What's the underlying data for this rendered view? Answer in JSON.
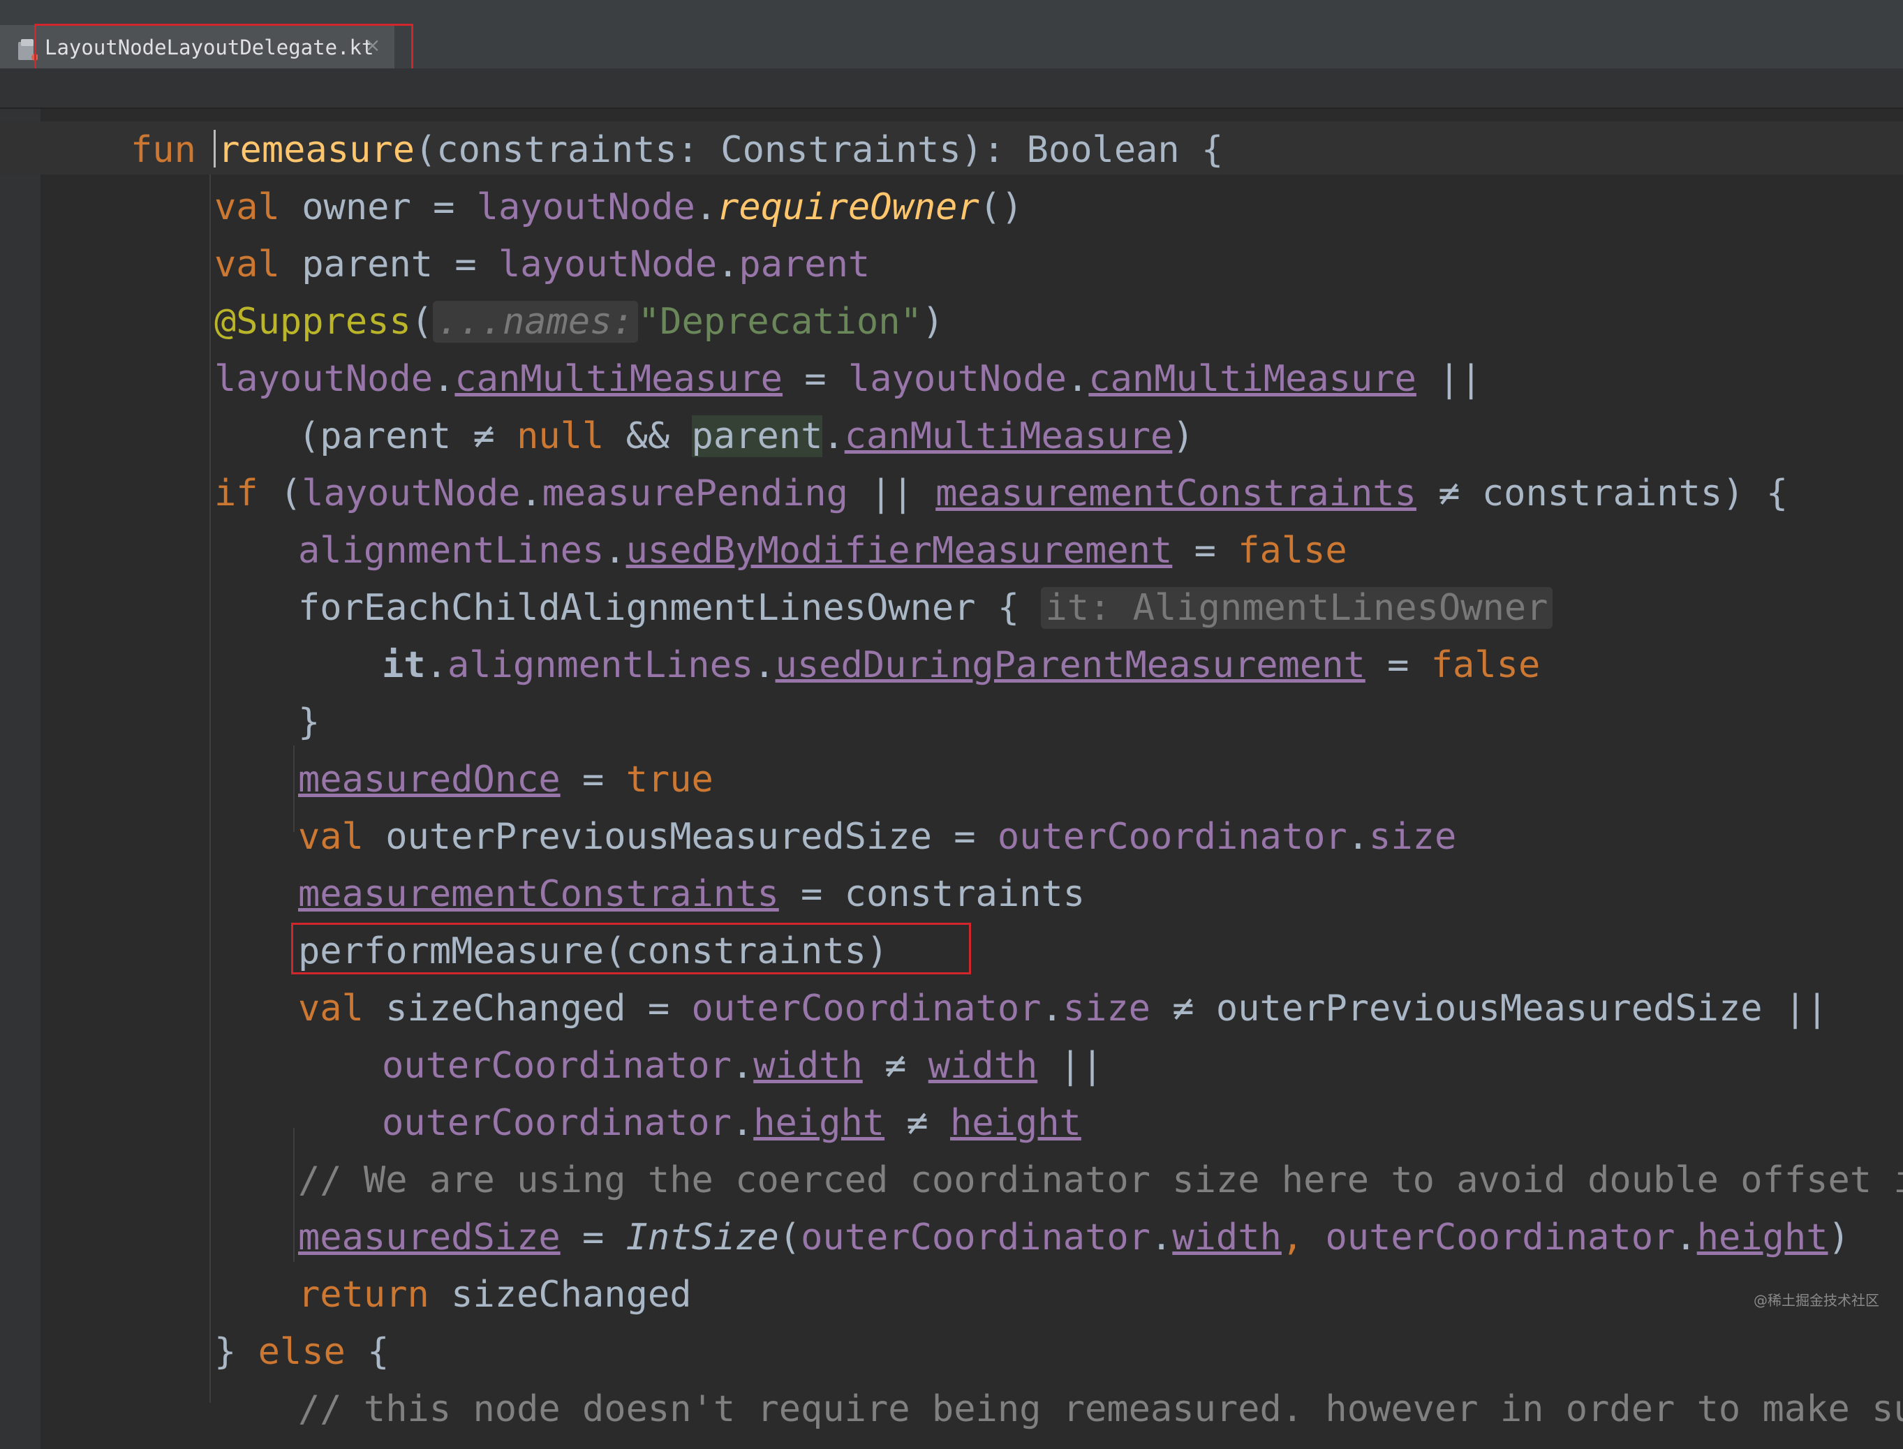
{
  "tab": {
    "title": "LayoutNodeLayoutDelegate.kt",
    "close_glyph": "×",
    "icon": "kotlin-file-icon"
  },
  "code": {
    "l1": {
      "fun": "fun ",
      "name": "remeasure",
      "sig": "(constraints: Constraints): Boolean {"
    },
    "l2": {
      "val": "val ",
      "a": "owner = ",
      "b": "layoutNode",
      "c": ".",
      "d": "requireOwner",
      "e": "()"
    },
    "l3": {
      "val": "val ",
      "a": "parent = ",
      "b": "layoutNode",
      "c": ".",
      "d": "parent"
    },
    "l4": {
      "ann": "@Suppress",
      "a": "(",
      "hint": "...names:",
      "str": "\"Deprecation\"",
      "b": ")"
    },
    "l5": {
      "a": "layoutNode",
      "b": ".",
      "c": "canMultiMeasure",
      "d": " = ",
      "e": "layoutNode",
      "f": ".",
      "g": "canMultiMeasure",
      "h": " ||"
    },
    "l6": {
      "a": "(parent ≠ ",
      "null": "null",
      "b": " && ",
      "c": "parent",
      "d": ".",
      "e": "canMultiMeasure",
      "f": ")"
    },
    "l7": {
      "if": "if ",
      "a": "(",
      "b": "layoutNode",
      "c": ".",
      "d": "measurePending",
      "e": " || ",
      "f": "measurementConstraints",
      "g": " ≠ constraints) {"
    },
    "l8": {
      "a": "alignmentLines",
      "b": ".",
      "c": "usedByModifierMeasurement",
      "d": " = ",
      "e": "false"
    },
    "l9": {
      "a": "forEachChildAlignmentLinesOwner {",
      "hint": "it: AlignmentLinesOwner"
    },
    "l10": {
      "a": "it",
      "b": ".",
      "c": "alignmentLines",
      "d": ".",
      "e": "usedDuringParentMeasurement",
      "f": " = ",
      "g": "false"
    },
    "l11": {
      "a": "}"
    },
    "l12": {
      "a": "measuredOnce",
      "b": " = ",
      "c": "true"
    },
    "l13": {
      "val": "val ",
      "a": "outerPreviousMeasuredSize = ",
      "b": "outerCoordinator",
      "c": ".",
      "d": "size"
    },
    "l14": {
      "a": "measurementConstraints",
      "b": " = constraints"
    },
    "l15": {
      "a": "performMeasure(constraints)"
    },
    "l16": {
      "val": "val ",
      "a": "sizeChanged = ",
      "b": "outerCoordinator",
      "c": ".",
      "d": "size",
      "e": " ≠ outerPreviousMeasuredSize ||"
    },
    "l17": {
      "a": "outerCoordinator",
      "b": ".",
      "c": "width",
      "d": " ≠ ",
      "e": "width",
      "f": " ||"
    },
    "l18": {
      "a": "outerCoordinator",
      "b": ".",
      "c": "height",
      "d": " ≠ ",
      "e": "height"
    },
    "l19": {
      "a": "// We are using the coerced coordinator size here to avoid double offset in l"
    },
    "l20": {
      "a": "measuredSize",
      "b": " = ",
      "c": "IntSize",
      "d": "(",
      "e": "outerCoordinator",
      "f": ".",
      "g": "width",
      "h": ", ",
      "i": "outerCoordinator",
      "j": ".",
      "k": "height",
      "l": ")"
    },
    "l21": {
      "ret": "return ",
      "a": "sizeChanged"
    },
    "l22": {
      "a": "} ",
      "else": "else",
      "b": " {"
    },
    "l23": {
      "a": "// this node doesn't require being remeasured. however in order to make sure"
    }
  },
  "watermark": "@稀土掘金技术社区",
  "colors": {
    "background": "#2b2b2b",
    "keyword": "#cc7832",
    "function": "#ffc66d",
    "property": "#9876aa",
    "string": "#6a8759",
    "annotation": "#bbb529",
    "comment": "#808080",
    "highlight_box": "#d2262d",
    "tab_underline": "#4a88c7"
  }
}
